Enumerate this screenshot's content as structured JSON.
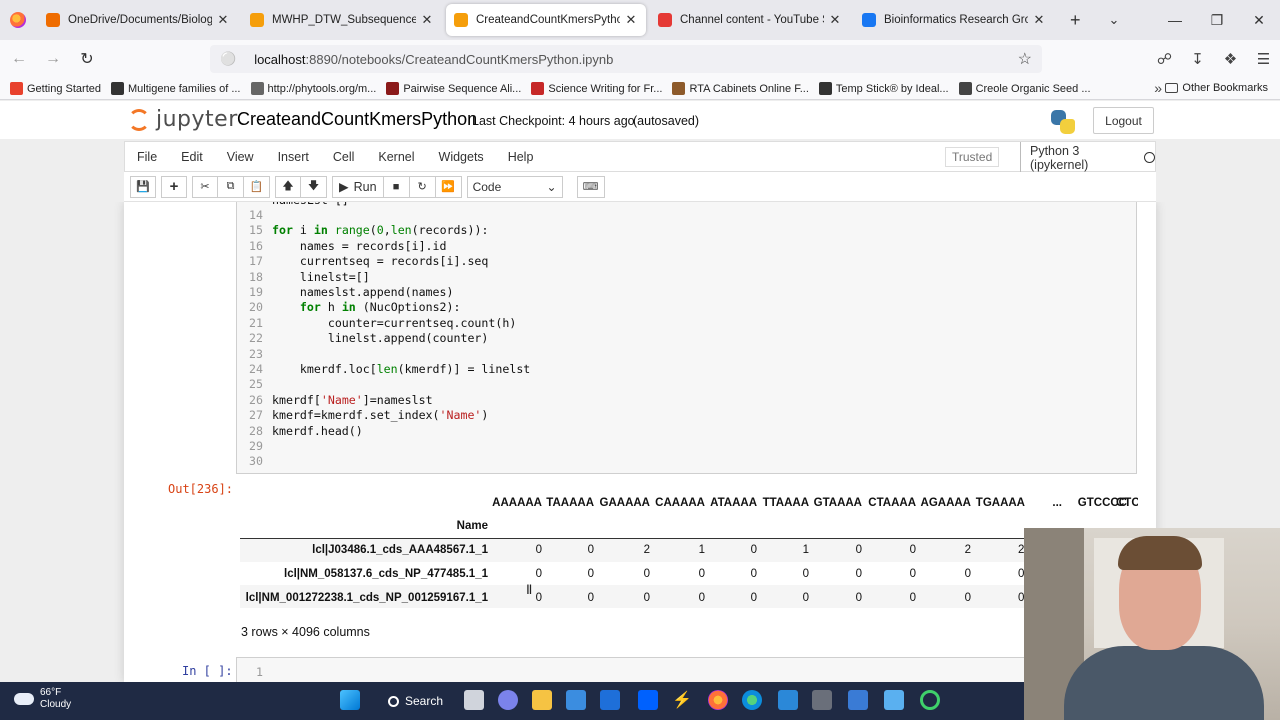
{
  "browser": {
    "tabs": [
      {
        "title": "OneDrive/Documents/Biology P",
        "color": "#ef6c00",
        "active": false
      },
      {
        "title": "MWHP_DTW_SubsequenceMatc",
        "color": "#f59e0b",
        "active": false
      },
      {
        "title": "CreateandCountKmersPython -",
        "color": "#f59e0b",
        "active": true
      },
      {
        "title": "Channel content - YouTube Stud",
        "color": "#e53935",
        "active": false
      },
      {
        "title": "Bioinformatics Research Group",
        "color": "#1877f2",
        "active": false
      }
    ],
    "url_host": "localhost",
    "url_path": ":8890/notebooks/CreateandCountKmersPython.ipynb",
    "bookmarks": [
      {
        "label": "Getting Started",
        "color": "#e8412d"
      },
      {
        "label": "Multigene families of ...",
        "color": "#333333"
      },
      {
        "label": "http://phytools.org/m...",
        "color": "#666666"
      },
      {
        "label": "Pairwise Sequence Ali...",
        "color": "#8b1a1a"
      },
      {
        "label": "Science Writing for Fr...",
        "color": "#c62828"
      },
      {
        "label": "RTA Cabinets Online F...",
        "color": "#8d5a2b"
      },
      {
        "label": "Temp Stick® by Ideal...",
        "color": "#333333"
      },
      {
        "label": "Creole Organic Seed ...",
        "color": "#444444"
      }
    ],
    "other_bookmarks": "Other Bookmarks"
  },
  "jupyter": {
    "logo_text": "jupyter",
    "notebook_title": "CreateandCountKmersPython",
    "checkpoint": "Last Checkpoint: 4 hours ago",
    "autosaved": "(autosaved)",
    "logout": "Logout",
    "menus": [
      "File",
      "Edit",
      "View",
      "Insert",
      "Cell",
      "Kernel",
      "Widgets",
      "Help"
    ],
    "trusted": "Trusted",
    "kernel": "Python 3 (ipykernel)",
    "run_label": "Run",
    "cell_type": "Code"
  },
  "code_lines": [
    {
      "n": "",
      "text": "namesLst=[]"
    },
    {
      "n": "14",
      "text": ""
    },
    {
      "n": "15",
      "text": "for i in range(0,len(records)):"
    },
    {
      "n": "16",
      "text": "    names = records[i].id"
    },
    {
      "n": "17",
      "text": "    currentseq = records[i].seq"
    },
    {
      "n": "18",
      "text": "    linelst=[]"
    },
    {
      "n": "19",
      "text": "    nameslst.append(names)"
    },
    {
      "n": "20",
      "text": "    for h in (NucOptions2):"
    },
    {
      "n": "21",
      "text": "        counter=currentseq.count(h)"
    },
    {
      "n": "22",
      "text": "        linelst.append(counter)"
    },
    {
      "n": "23",
      "text": ""
    },
    {
      "n": "24",
      "text": "    kmerdf.loc[len(kmerdf)] = linelst"
    },
    {
      "n": "25",
      "text": ""
    },
    {
      "n": "26",
      "text": "kmerdf['Name']=nameslst"
    },
    {
      "n": "27",
      "text": "kmerdf=kmerdf.set_index('Name')"
    },
    {
      "n": "28",
      "text": "kmerdf.head()"
    },
    {
      "n": "29",
      "text": ""
    },
    {
      "n": "30",
      "text": ""
    }
  ],
  "output": {
    "out_prompt": "Out[236]:",
    "columns": [
      "AAAAAA",
      "TAAAAA",
      "GAAAAA",
      "CAAAAA",
      "ATAAAA",
      "TTAAAA",
      "GTAAAA",
      "CTAAAA",
      "AGAAAA",
      "TGAAAA",
      "...",
      "GTCCCC",
      "CTC"
    ],
    "index_name": "Name",
    "rows": [
      {
        "name": "lcl|J03486.1_cds_AAA48567.1_1",
        "values": [
          "0",
          "0",
          "2",
          "1",
          "0",
          "1",
          "0",
          "0",
          "2",
          "2"
        ]
      },
      {
        "name": "lcl|NM_058137.6_cds_NP_477485.1_1",
        "values": [
          "0",
          "0",
          "0",
          "0",
          "0",
          "0",
          "0",
          "0",
          "0",
          "0"
        ]
      },
      {
        "name": "lcl|NM_001272238.1_cds_NP_001259167.1_1",
        "values": [
          "0",
          "0",
          "0",
          "0",
          "0",
          "0",
          "0",
          "0",
          "0",
          "0"
        ]
      }
    ],
    "shape": "3 rows × 4096 columns",
    "in_prompt": "In [ ]:",
    "new_cell_line": "1"
  },
  "taskbar": {
    "temp": "66°F",
    "weather": "Cloudy",
    "search": "Search"
  }
}
